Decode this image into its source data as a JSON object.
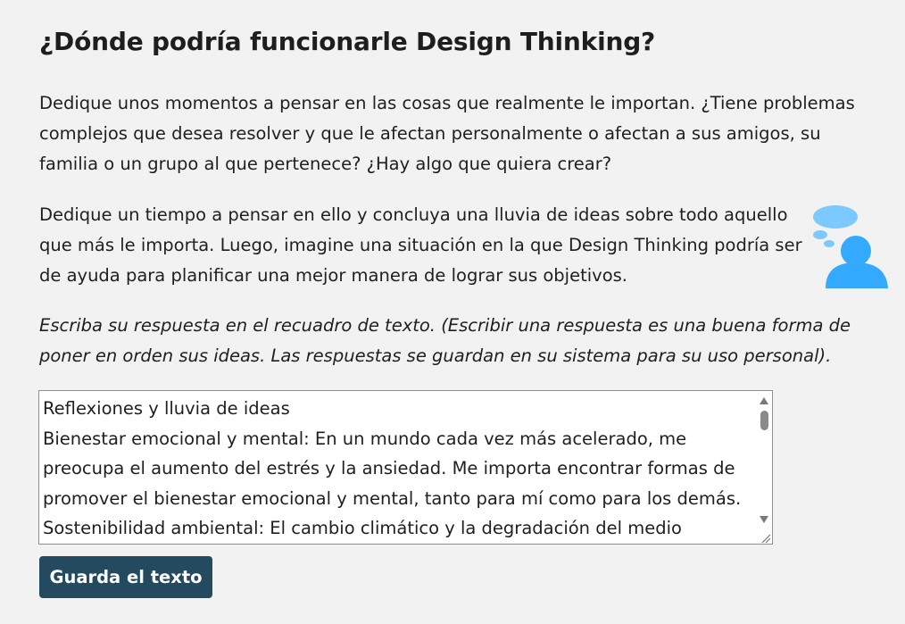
{
  "page": {
    "title": "¿Dónde podría funcionarle Design Thinking?",
    "paragraph1": "Dedique unos momentos a pensar en las cosas que realmente le importan. ¿Tiene problemas complejos que desea resolver y que le afectan personalmente o afectan a sus amigos, su familia o un grupo al que pertenece? ¿Hay algo que quiera crear?",
    "paragraph2": "Dedique un tiempo a pensar en ello y concluya una lluvia de ideas sobre todo aquello que más le importa. Luego, imagine una situación en la que Design Thinking podría ser de ayuda para planificar una mejor manera de lograr sus objetivos.",
    "instruction": "Escriba su respuesta en el recuadro de texto. (Escribir una respuesta es una buena forma de poner en orden sus ideas. Las respuestas se guardan en su sistema para su uso personal)."
  },
  "illustration": {
    "icon": "person-thinking-icon",
    "color": "#33aaff"
  },
  "response_box": {
    "lines": [
      "Reflexiones y lluvia de ideas",
      "Bienestar emocional y mental: En un mundo cada vez más acelerado, me",
      "preocupa el aumento del estrés y la ansiedad. Me importa encontrar formas de",
      "promover el bienestar emocional y mental, tanto para mí como para los demás.",
      "Sostenibilidad ambiental: El cambio climático y la degradación del medio"
    ]
  },
  "save_button": {
    "label": "Guarda el texto",
    "color": "#234a5f"
  }
}
